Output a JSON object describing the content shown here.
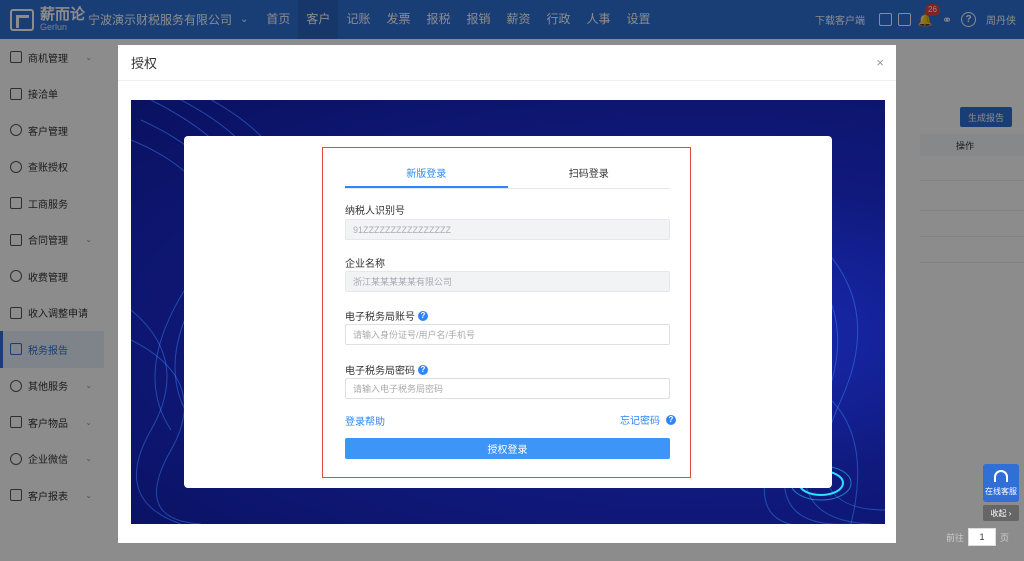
{
  "topbar": {
    "logo_cn": "薪而论",
    "logo_en": "Gerlun",
    "company": "宁波演示财税服务有限公司",
    "nav": [
      "首页",
      "客户",
      "记账",
      "发票",
      "报税",
      "报销",
      "薪资",
      "行政",
      "人事",
      "设置"
    ],
    "active_nav": "客户",
    "download_client": "下载客户端",
    "notification_count": "26",
    "user": "周丹侠"
  },
  "sidebar": {
    "items": [
      {
        "label": "商机管理",
        "icon": "home-icon",
        "chevron": true
      },
      {
        "label": "接洽单",
        "icon": "handshake-icon",
        "chevron": false
      },
      {
        "label": "客户管理",
        "icon": "user-icon",
        "chevron": false
      },
      {
        "label": "查账授权",
        "icon": "user-key-icon",
        "chevron": false
      },
      {
        "label": "工商服务",
        "icon": "id-card-icon",
        "chevron": false
      },
      {
        "label": "合同管理",
        "icon": "contract-icon",
        "chevron": true
      },
      {
        "label": "收费管理",
        "icon": "yen-icon",
        "chevron": false
      },
      {
        "label": "收入调整申请",
        "icon": "form-icon",
        "chevron": false
      },
      {
        "label": "税务报告",
        "icon": "report-icon",
        "chevron": false,
        "active": true
      },
      {
        "label": "其他服务",
        "icon": "heart-icon",
        "chevron": true
      },
      {
        "label": "客户物品",
        "icon": "box-icon",
        "chevron": true
      },
      {
        "label": "企业微信",
        "icon": "wechat-icon",
        "chevron": true
      },
      {
        "label": "客户报表",
        "icon": "chart-icon",
        "chevron": true
      }
    ]
  },
  "background": {
    "generate_report": "生成报告",
    "col_operation": "操作",
    "customer_service": "在线客服",
    "collapse": "收起",
    "pager_goto": "前往",
    "pager_value": "1",
    "pager_unit": "页"
  },
  "dialog": {
    "title": "授权",
    "close": "×",
    "tabs": [
      "新版登录",
      "扫码登录"
    ],
    "taxpayer_id_label": "纳税人识别号",
    "taxpayer_id_value": "91ZZZZZZZZZZZZZZZZ",
    "company_name_label": "企业名称",
    "company_name_value": "浙江某某某某某有限公司",
    "account_label": "电子税务局账号",
    "account_placeholder": "请输入身份证号/用户名/手机号",
    "password_label": "电子税务局密码",
    "password_placeholder": "请输入电子税务局密码",
    "help_link": "登录帮助",
    "forgot_link": "忘记密码",
    "submit": "授权登录"
  }
}
